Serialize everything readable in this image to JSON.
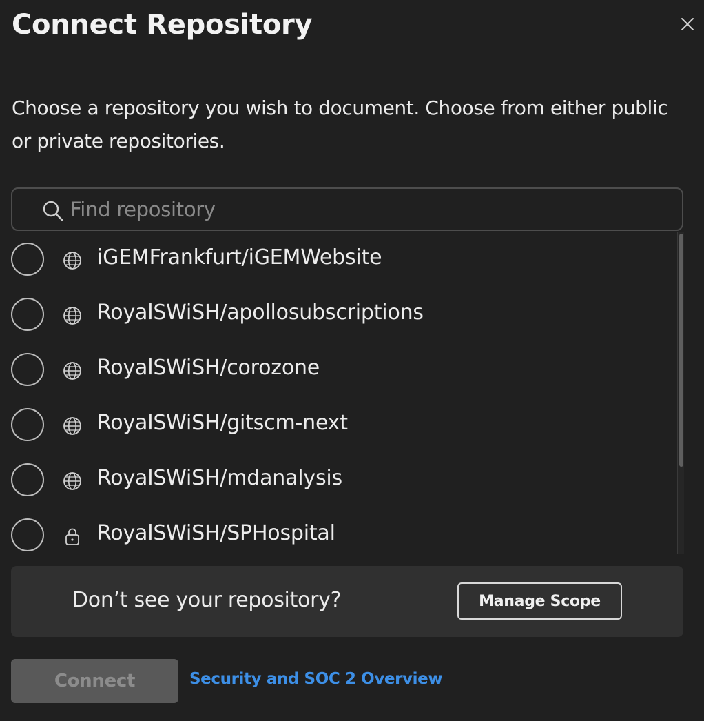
{
  "dialog": {
    "title": "Connect Repository",
    "description": "Choose a repository you wish to document. Choose from either public or private repositories."
  },
  "search": {
    "placeholder": "Find repository",
    "value": ""
  },
  "repositories": [
    {
      "name": "iGEMFrankfurt/iGEMWebsite",
      "visibility": "public",
      "icon": "globe-icon",
      "selected": false
    },
    {
      "name": "RoyalSWiSH/apollosubscriptions",
      "visibility": "public",
      "icon": "globe-icon",
      "selected": false
    },
    {
      "name": "RoyalSWiSH/corozone",
      "visibility": "public",
      "icon": "globe-icon",
      "selected": false
    },
    {
      "name": "RoyalSWiSH/gitscm-next",
      "visibility": "public",
      "icon": "globe-icon",
      "selected": false
    },
    {
      "name": "RoyalSWiSH/mdanalysis",
      "visibility": "public",
      "icon": "globe-icon",
      "selected": false
    },
    {
      "name": "RoyalSWiSH/SPHospital",
      "visibility": "private",
      "icon": "lock-icon",
      "selected": false
    }
  ],
  "scope": {
    "text": "Don’t see your repository?",
    "button_label": "Manage Scope"
  },
  "footer": {
    "connect_label": "Connect",
    "connect_disabled": true,
    "security_link": "Security and SOC 2 Overview"
  },
  "colors": {
    "background": "#202020",
    "panel": "#303030",
    "link": "#3d8fe6",
    "disabled_button": "#595959"
  }
}
